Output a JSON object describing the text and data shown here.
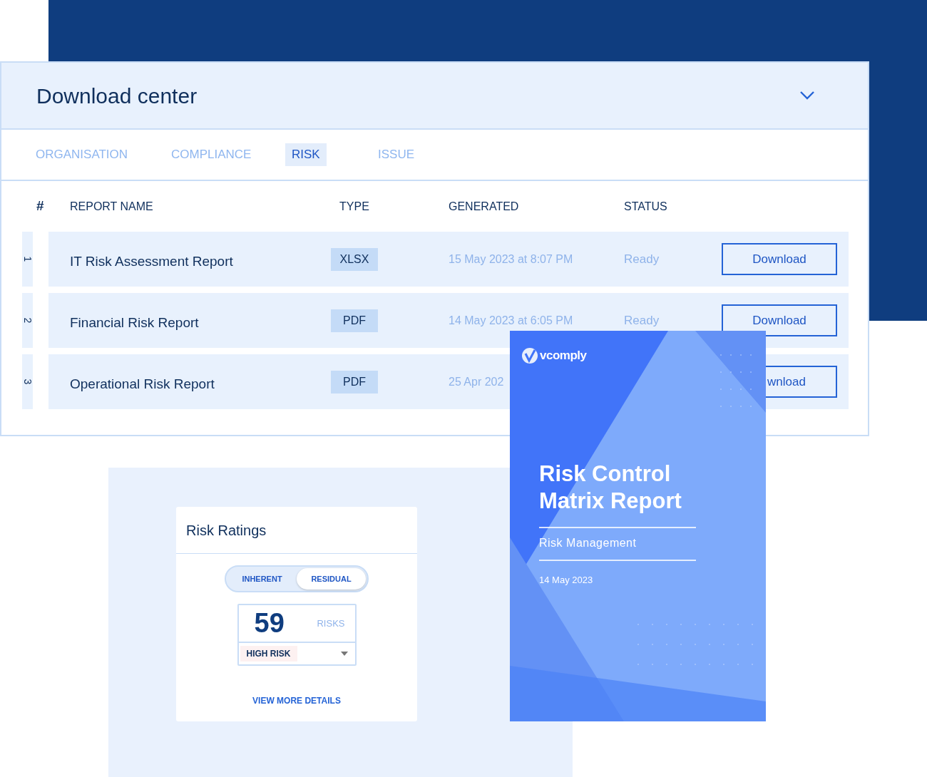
{
  "download_center": {
    "title": "Download center",
    "tabs": [
      {
        "label": "ORGANISATION",
        "selected": false
      },
      {
        "label": "COMPLIANCE",
        "selected": false
      },
      {
        "label": "RISK",
        "selected": true
      },
      {
        "label": "ISSUE",
        "selected": false
      }
    ],
    "columns": [
      "#",
      "REPORT NAME",
      "TYPE",
      "GENERATED",
      "STATUS"
    ],
    "rows": [
      {
        "number": "1",
        "name": "IT Risk Assessment Report",
        "type": "XLSX",
        "generated": "15 May 2023 at 8:07 PM",
        "status": "Ready",
        "action": "Download"
      },
      {
        "number": "2",
        "name": "Financial Risk Report",
        "type": "PDF",
        "generated": "14 May 2023 at 6:05 PM",
        "status": "Ready",
        "action": "Download"
      },
      {
        "number": "3",
        "name": "Operational Risk Report",
        "type": "PDF",
        "generated": "25 Apr 202",
        "action": "wnload"
      }
    ]
  },
  "risk_ratings": {
    "title": "Risk Ratings",
    "toggle": [
      {
        "label": "INHERENT",
        "selected": false
      },
      {
        "label": "RESIDUAL",
        "selected": true
      }
    ],
    "count": "59",
    "count_label": "RISKS",
    "filter": "HIGH RISK",
    "link": "VIEW MORE DETAILS"
  },
  "report_cover": {
    "logo": "vcomply",
    "title": "Risk Control Matrix Report",
    "subtitle": "Risk Management",
    "date": "14 May 2023"
  }
}
